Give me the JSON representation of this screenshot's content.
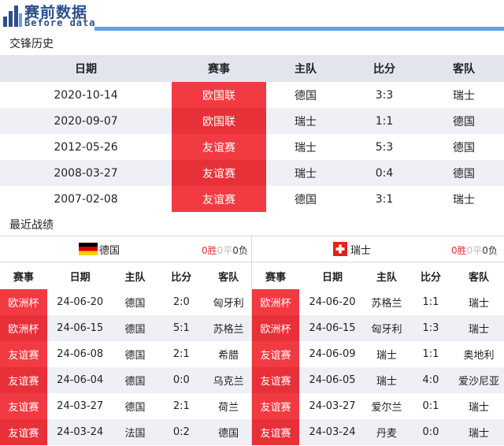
{
  "colors": {
    "accent_blue": "#5aa3e6",
    "comp_red": "#f23a43",
    "brand_navy": "#2b4f8c"
  },
  "header": {
    "logo_icon": "bar-chart-icon",
    "title": "赛前数据",
    "subtitle": "Before data"
  },
  "h2h": {
    "section_title": "交锋历史",
    "columns": {
      "date": "日期",
      "comp": "赛事",
      "home": "主队",
      "score": "比分",
      "away": "客队"
    },
    "rows": [
      {
        "date": "2020-10-14",
        "comp": "欧国联",
        "home": "德国",
        "score": "3:3",
        "away": "瑞士"
      },
      {
        "date": "2020-09-07",
        "comp": "欧国联",
        "home": "瑞士",
        "score": "1:1",
        "away": "德国"
      },
      {
        "date": "2012-05-26",
        "comp": "友谊赛",
        "home": "瑞士",
        "score": "5:3",
        "away": "德国"
      },
      {
        "date": "2008-03-27",
        "comp": "友谊赛",
        "home": "瑞士",
        "score": "0:4",
        "away": "德国"
      },
      {
        "date": "2007-02-08",
        "comp": "友谊赛",
        "home": "德国",
        "score": "3:1",
        "away": "瑞士"
      }
    ]
  },
  "recent": {
    "section_title": "最近战绩",
    "columns": {
      "comp": "赛事",
      "date": "日期",
      "home": "主队",
      "score": "比分",
      "away": "客队"
    },
    "left": {
      "team": "德国",
      "flag_icon": "germany-flag-icon",
      "wins": "0胜",
      "draws": "0平",
      "losses": "0负",
      "rows": [
        {
          "comp": "欧洲杯",
          "date": "24-06-20",
          "home": "德国",
          "score": "2:0",
          "away": "匈牙利"
        },
        {
          "comp": "欧洲杯",
          "date": "24-06-15",
          "home": "德国",
          "score": "5:1",
          "away": "苏格兰"
        },
        {
          "comp": "友谊赛",
          "date": "24-06-08",
          "home": "德国",
          "score": "2:1",
          "away": "希腊"
        },
        {
          "comp": "友谊赛",
          "date": "24-06-04",
          "home": "德国",
          "score": "0:0",
          "away": "乌克兰"
        },
        {
          "comp": "友谊赛",
          "date": "24-03-27",
          "home": "德国",
          "score": "2:1",
          "away": "荷兰"
        },
        {
          "comp": "友谊赛",
          "date": "24-03-24",
          "home": "法国",
          "score": "0:2",
          "away": "德国"
        }
      ]
    },
    "right": {
      "team": "瑞士",
      "flag_icon": "switzerland-flag-icon",
      "wins": "0胜",
      "draws": "0平",
      "losses": "0负",
      "rows": [
        {
          "comp": "欧洲杯",
          "date": "24-06-20",
          "home": "苏格兰",
          "score": "1:1",
          "away": "瑞士"
        },
        {
          "comp": "欧洲杯",
          "date": "24-06-15",
          "home": "匈牙利",
          "score": "1:3",
          "away": "瑞士"
        },
        {
          "comp": "友谊赛",
          "date": "24-06-09",
          "home": "瑞士",
          "score": "1:1",
          "away": "奥地利"
        },
        {
          "comp": "友谊赛",
          "date": "24-06-05",
          "home": "瑞士",
          "score": "4:0",
          "away": "爱沙尼亚"
        },
        {
          "comp": "友谊赛",
          "date": "24-03-27",
          "home": "爱尔兰",
          "score": "0:1",
          "away": "瑞士"
        },
        {
          "comp": "友谊赛",
          "date": "24-03-24",
          "home": "丹麦",
          "score": "0:0",
          "away": "瑞士"
        }
      ]
    }
  }
}
